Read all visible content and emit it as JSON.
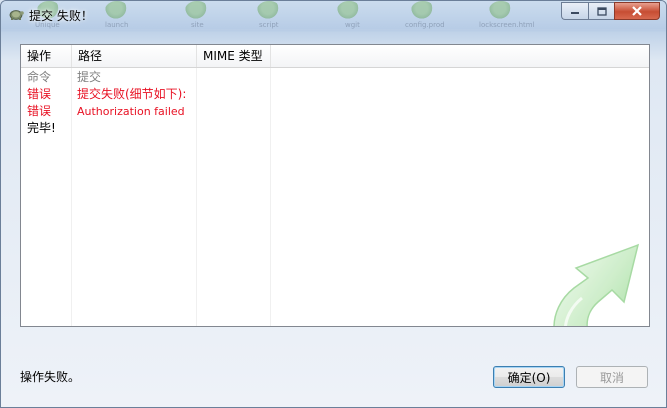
{
  "window": {
    "title": "提交 失败！",
    "background_labels": [
      "Unique",
      "launch",
      "site",
      "script",
      "wgit",
      "config.prod",
      "lockscreen.html"
    ]
  },
  "list": {
    "columns": [
      "操作",
      "路径",
      "MIME 类型"
    ],
    "rows": [
      {
        "op": "命令",
        "path": "提交",
        "color": "#808080"
      },
      {
        "op": "错误",
        "path": "提交失败(细节如下):",
        "color": "#e81123"
      },
      {
        "op": "错误",
        "path": "Authorization failed",
        "color": "#e81123"
      },
      {
        "op": "完毕!",
        "path": "",
        "color": "#000000"
      }
    ]
  },
  "status_text": "操作失败。",
  "buttons": {
    "ok": "确定(O)",
    "cancel": "取消"
  },
  "colors": {
    "error": "#e81123",
    "command": "#808080",
    "accent_arrow": "#7ed07a"
  },
  "icons": {
    "app": "tortoise-icon",
    "minimize": "minimize-icon",
    "maximize": "maximize-icon",
    "close": "close-icon",
    "decoration": "curved-arrow-icon"
  }
}
